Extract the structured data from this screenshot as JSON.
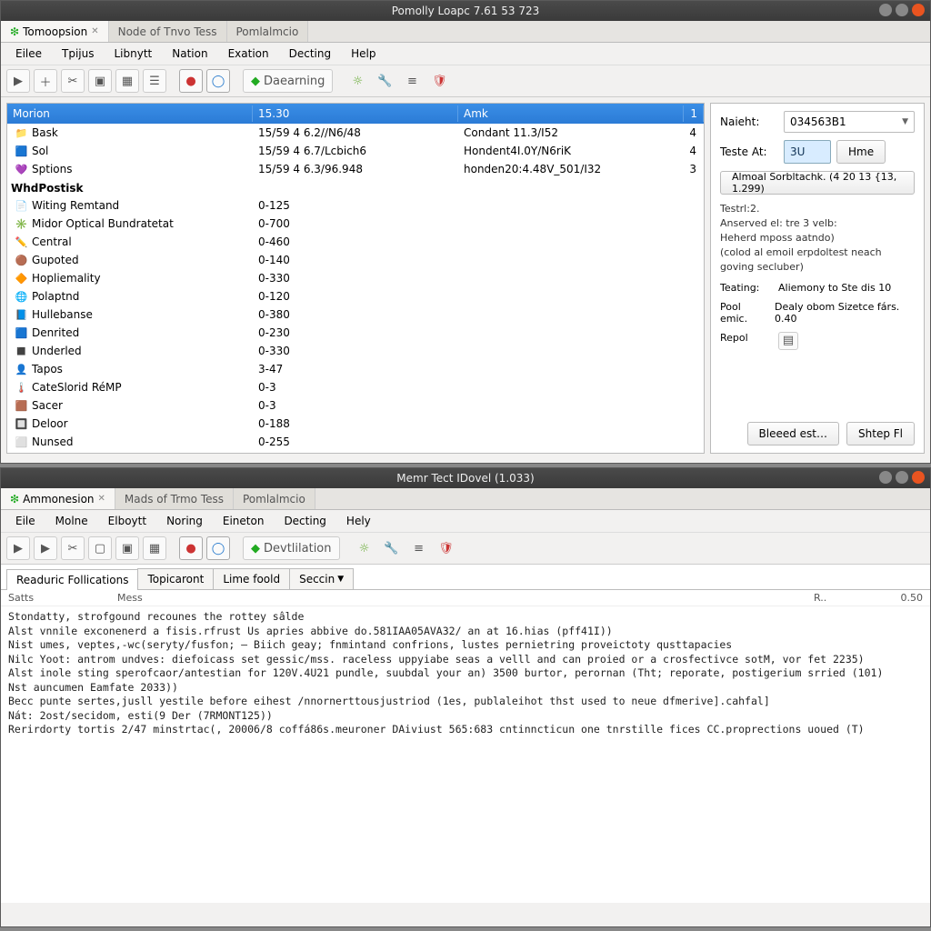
{
  "window1": {
    "title": "Pomolly Loapc 7.61 53 723",
    "tabs": [
      {
        "label": "Tomoopsion",
        "active": true
      },
      {
        "label": "Node of Tnvo Tess",
        "active": false
      },
      {
        "label": "Pomlalmcio",
        "active": false
      }
    ],
    "menu": [
      "Eilee",
      "Tpijus",
      "Libnytt",
      "Nation",
      "Exation",
      "Decting",
      "Help"
    ],
    "toolbar_learning": "Daearning",
    "columns": [
      "Morion",
      "15.30",
      "Amk",
      "1"
    ],
    "rows_top": [
      {
        "icon": "📁",
        "c0": "Bask",
        "c1": "15/59 4  6.2//N6/48",
        "c2": "Condant 11.3/I52",
        "c3": "4"
      },
      {
        "icon": "🟦",
        "c0": "Sol",
        "c1": "15/59 4  6.7/Lcbich6",
        "c2": "Hondent4I.0Y/N6riK",
        "c3": "4"
      },
      {
        "icon": "💜",
        "c0": "Sptions",
        "c1": "15/59 4  6.3/96.948",
        "c2": "honden20:4.48V_501/I32",
        "c3": "3"
      }
    ],
    "section_title": "WhdPostisk",
    "rows_section": [
      {
        "icon": "📄",
        "c0": "Witing Remtand",
        "c1": "0-125"
      },
      {
        "icon": "✳️",
        "c0": "Midor Optical Bundratetat",
        "c1": "0-700"
      },
      {
        "icon": "✏️",
        "c0": "Central",
        "c1": "0-460"
      },
      {
        "icon": "🟤",
        "c0": "Gupoted",
        "c1": "0-140"
      },
      {
        "icon": "🔶",
        "c0": "Hopliemality",
        "c1": "0-330"
      },
      {
        "icon": "🌐",
        "c0": "Polaptnd",
        "c1": "0-120"
      },
      {
        "icon": "📘",
        "c0": "Hullebanse",
        "c1": "0-380"
      },
      {
        "icon": "🟦",
        "c0": "Denrited",
        "c1": "0-230"
      },
      {
        "icon": "◼️",
        "c0": "Underled",
        "c1": "0-330"
      },
      {
        "icon": "👤",
        "c0": "Tapos",
        "c1": "3-47"
      },
      {
        "icon": "🌡️",
        "c0": "CateSlorid RéMP",
        "c1": "0-3"
      },
      {
        "icon": "🟫",
        "c0": "Sacer",
        "c1": "0-3"
      },
      {
        "icon": "🔲",
        "c0": "Deloor",
        "c1": "0-188"
      },
      {
        "icon": "⬜",
        "c0": "Nunsed",
        "c1": "0-255"
      }
    ],
    "side": {
      "naieht_label": "Naieht:",
      "naieht_value": "034563B1",
      "teste_label": "Teste At:",
      "teste_value": "3U",
      "hme_btn": "Hme",
      "wide_btn": "Almoal Sorbltachk. (4 20 13 {13, 1.299)",
      "info_title": "Testrl:2.",
      "info_lines": [
        "Anserved el: tre 3 velb:",
        "Heherd mposs aatndo)",
        "(colod al emoil erpdoltest neach goving secluber)"
      ],
      "teating_label": "Teating:",
      "teating_value": "Aliemony to Ste dis 10",
      "pool_label": "Pool emic.",
      "pool_value": "Dealy obom Sizetce fárs. 0.40",
      "repol_label": "Repol",
      "btn_bleed": "Bleeed est…",
      "btn_shtep": "Shtep Fl"
    }
  },
  "window2": {
    "title": "Memr Tect IDovel (1.033)",
    "tabs": [
      {
        "label": "Ammonesion",
        "active": true
      },
      {
        "label": "Mads of Trmo Tess",
        "active": false
      },
      {
        "label": "Pomlalmcio",
        "active": false
      }
    ],
    "menu": [
      "Eile",
      "Molne",
      "Elboytt",
      "Noring",
      "Eineton",
      "Decting",
      "Hely"
    ],
    "toolbar_action": "Devtlilation",
    "subtabs": [
      "Readuric Follications",
      "Topicaront",
      "Lime foold",
      "Seccin"
    ],
    "loghead": {
      "c0": "Satts",
      "c1": "Mess",
      "c2": "R..",
      "c3": "0.50"
    },
    "loglines": [
      "Stondatty, strofgound recounes the rottey sâlde",
      "Alst vnnile exconenerd a fisis.rfrust Us apries abbive do.581IAA05AVA32/ an at 16.hias (pff41I))",
      "Nist umes, veptes,-wc(seryty/fusfon; – Biich geay; fnmintand confrions, lustes pernietring proveictoty qusttapacies",
      "Nilc Yoot: antrom undves: diefoicass set gessic/mss. raceless uppyiabe seas a velll and can proied or a crosfectivce sotM, vor fet 2235)",
      "Alst inole sting sperofcaor/antestian for 120V.4U21 pundle, suubdal your an) 3500 burtor, perornan (Tht; reporate, postigerium srried (101)",
      "Nst auncumen Eamfate 2033))",
      "Becc punte sertes,jusll yestile before eihest /nnornerttousjustriod (1es, publaleihot thst used to neue dfmerive].cahfal]",
      "Nát: 2ost/secidom, esti(9 Der (7RMONT125))",
      "Rerirdorty tortis 2/47 minstrtac(, 20006/8 coffá86s.meuroner DAiviust 565:683 cntinncticun one tnrstille fices CC.proprections uoued (T)"
    ]
  }
}
